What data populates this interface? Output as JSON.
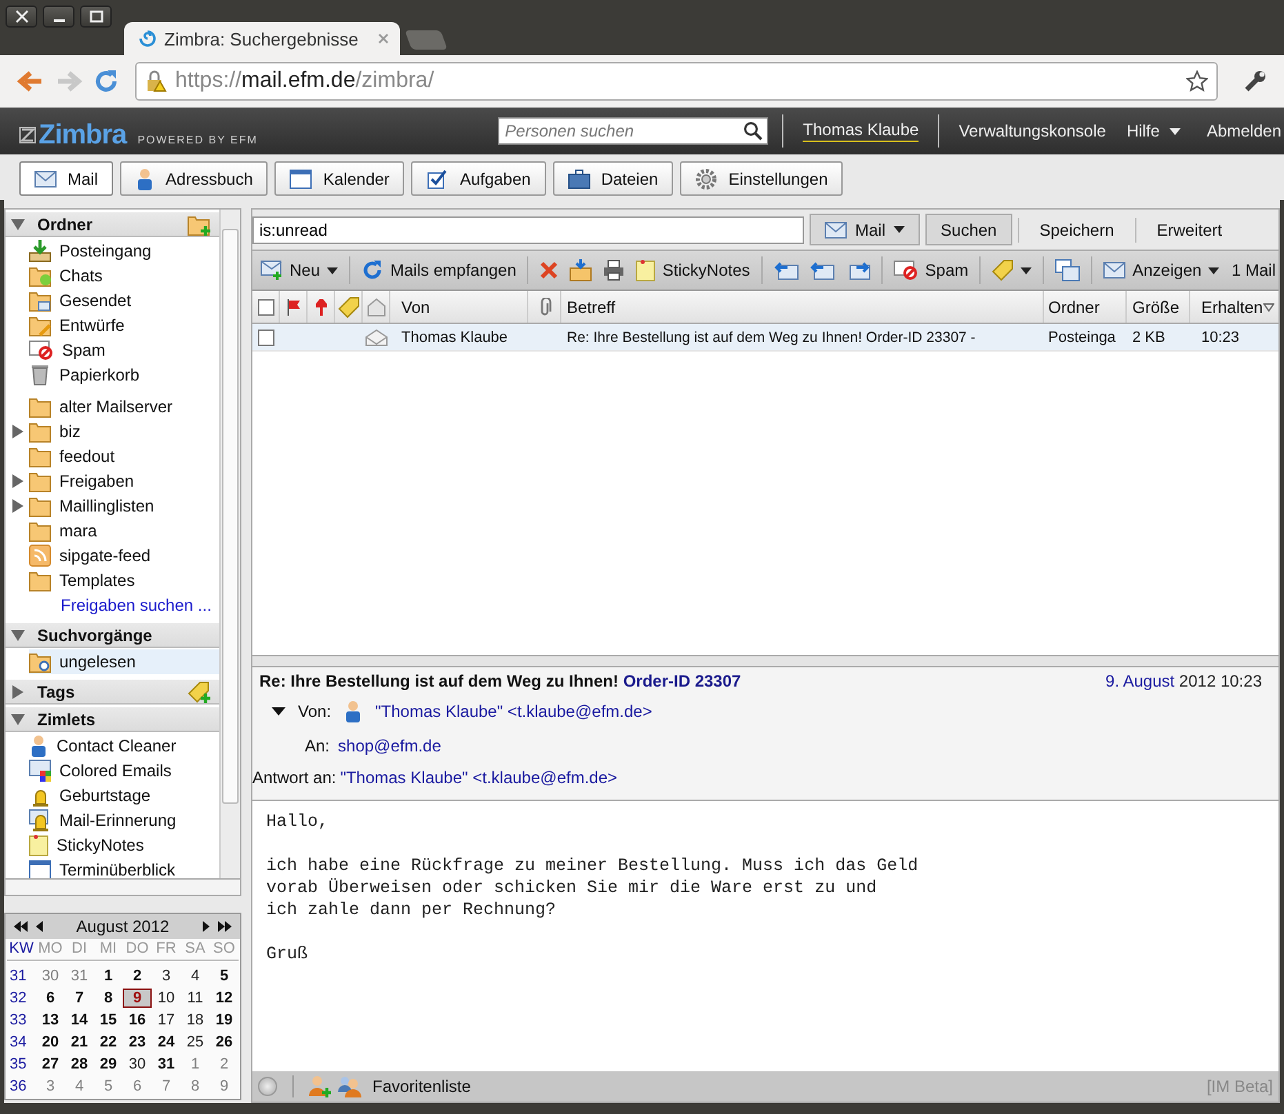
{
  "browser": {
    "tab_title": "Zimbra: Suchergebnisse",
    "url": {
      "scheme": "https://",
      "host": "mail.efm.de",
      "path": "/zimbra/"
    }
  },
  "header": {
    "logo": "Zimbra",
    "powered": "POWERED BY EFM",
    "people_search": {
      "placeholder": "Personen suchen"
    },
    "user": "Thomas Klaube",
    "links": [
      "Verwaltungskonsole",
      "Hilfe",
      "Abmelden"
    ]
  },
  "app_tabs": [
    {
      "label": "Mail",
      "kind": "mail",
      "selected": true
    },
    {
      "label": "Adressbuch",
      "kind": "contacts",
      "selected": false
    },
    {
      "label": "Kalender",
      "kind": "calendar",
      "selected": false
    },
    {
      "label": "Aufgaben",
      "kind": "tasks",
      "selected": false
    },
    {
      "label": "Dateien",
      "kind": "briefcase",
      "selected": false
    },
    {
      "label": "Einstellungen",
      "kind": "prefs",
      "selected": false
    }
  ],
  "sidebar": {
    "sections": [
      {
        "title": "Ordner",
        "expanded": true,
        "kind": "folders",
        "items": [
          {
            "label": "Posteingang",
            "kind": "inbox",
            "has_children": false,
            "selected": false
          },
          {
            "label": "Chats",
            "kind": "chats",
            "has_children": false,
            "selected": false
          },
          {
            "label": "Gesendet",
            "kind": "sent",
            "has_children": false,
            "selected": false
          },
          {
            "label": "Entwürfe",
            "kind": "drafts",
            "has_children": false,
            "selected": false
          },
          {
            "label": "Spam",
            "kind": "spam",
            "has_children": false,
            "selected": false
          },
          {
            "label": "Papierkorb",
            "kind": "trash",
            "has_children": false,
            "selected": false
          },
          {
            "label": "alter Mailserver",
            "kind": "folder",
            "has_children": false,
            "selected": false
          },
          {
            "label": "biz",
            "kind": "folder",
            "has_children": true,
            "selected": false
          },
          {
            "label": "feedout",
            "kind": "folder",
            "has_children": false,
            "selected": false
          },
          {
            "label": "Freigaben",
            "kind": "folder",
            "has_children": true,
            "selected": false
          },
          {
            "label": "Maillinglisten",
            "kind": "folder",
            "has_children": true,
            "selected": false
          },
          {
            "label": "mara",
            "kind": "folder",
            "has_children": false,
            "selected": false
          },
          {
            "label": "sipgate-feed",
            "kind": "rss",
            "has_children": false,
            "selected": false
          },
          {
            "label": "Templates",
            "kind": "folder",
            "has_children": false,
            "selected": false
          },
          {
            "label": "Freigaben suchen ...",
            "kind": "link"
          }
        ]
      },
      {
        "title": "Suchvorgänge",
        "expanded": true,
        "kind": "searches",
        "items": [
          {
            "label": "ungelesen",
            "kind": "search",
            "has_children": false,
            "selected": true
          }
        ]
      },
      {
        "title": "Tags",
        "expanded": false,
        "kind": "tags"
      },
      {
        "title": "Zimlets",
        "expanded": true,
        "kind": "zimlets",
        "items": [
          {
            "label": "Contact Cleaner",
            "kind": "cleaner",
            "has_children": false,
            "selected": false
          },
          {
            "label": "Colored Emails",
            "kind": "colored",
            "has_children": false,
            "selected": false
          },
          {
            "label": "Geburtstage",
            "kind": "bell",
            "has_children": false,
            "selected": false
          },
          {
            "label": "Mail-Erinnerung",
            "kind": "mailbell",
            "has_children": false,
            "selected": false
          },
          {
            "label": "StickyNotes",
            "kind": "note",
            "has_children": false,
            "selected": false
          },
          {
            "label": "Terminüberblick",
            "kind": "calendar",
            "has_children": false,
            "selected": false
          }
        ]
      }
    ]
  },
  "mini_calendar": {
    "title": "August 2012",
    "headers": [
      "KW",
      "MO",
      "DI",
      "MI",
      "DO",
      "FR",
      "SA",
      "SO"
    ],
    "weeks": [
      {
        "kw": "31",
        "days": [
          {
            "d": "30",
            "kind": "other",
            "selected": false
          },
          {
            "d": "31",
            "kind": "other",
            "selected": false
          },
          {
            "d": "1",
            "kind": "bold",
            "selected": false
          },
          {
            "d": "2",
            "kind": "bold",
            "selected": false
          },
          {
            "d": "3",
            "kind": "plain",
            "selected": false
          },
          {
            "d": "4",
            "kind": "plain",
            "selected": false
          },
          {
            "d": "5",
            "kind": "bold",
            "selected": false
          }
        ]
      },
      {
        "kw": "32",
        "days": [
          {
            "d": "6",
            "kind": "bold",
            "selected": false
          },
          {
            "d": "7",
            "kind": "bold",
            "selected": false
          },
          {
            "d": "8",
            "kind": "bold",
            "selected": false
          },
          {
            "d": "9",
            "kind": "bold",
            "selected": true
          },
          {
            "d": "10",
            "kind": "plain",
            "selected": false
          },
          {
            "d": "11",
            "kind": "plain",
            "selected": false
          },
          {
            "d": "12",
            "kind": "bold",
            "selected": false
          }
        ]
      },
      {
        "kw": "33",
        "days": [
          {
            "d": "13",
            "kind": "bold",
            "selected": false
          },
          {
            "d": "14",
            "kind": "bold",
            "selected": false
          },
          {
            "d": "15",
            "kind": "bold",
            "selected": false
          },
          {
            "d": "16",
            "kind": "bold",
            "selected": false
          },
          {
            "d": "17",
            "kind": "plain",
            "selected": false
          },
          {
            "d": "18",
            "kind": "plain",
            "selected": false
          },
          {
            "d": "19",
            "kind": "bold",
            "selected": false
          }
        ]
      },
      {
        "kw": "34",
        "days": [
          {
            "d": "20",
            "kind": "bold",
            "selected": false
          },
          {
            "d": "21",
            "kind": "bold",
            "selected": false
          },
          {
            "d": "22",
            "kind": "bold",
            "selected": false
          },
          {
            "d": "23",
            "kind": "bold",
            "selected": false
          },
          {
            "d": "24",
            "kind": "bold",
            "selected": false
          },
          {
            "d": "25",
            "kind": "plain",
            "selected": false
          },
          {
            "d": "26",
            "kind": "bold",
            "selected": false
          }
        ]
      },
      {
        "kw": "35",
        "days": [
          {
            "d": "27",
            "kind": "bold",
            "selected": false
          },
          {
            "d": "28",
            "kind": "bold",
            "selected": false
          },
          {
            "d": "29",
            "kind": "bold",
            "selected": false
          },
          {
            "d": "30",
            "kind": "plain",
            "selected": false
          },
          {
            "d": "31",
            "kind": "bold",
            "selected": false
          },
          {
            "d": "1",
            "kind": "other",
            "selected": false
          },
          {
            "d": "2",
            "kind": "other",
            "selected": false
          }
        ]
      },
      {
        "kw": "36",
        "days": [
          {
            "d": "3",
            "kind": "other",
            "selected": false
          },
          {
            "d": "4",
            "kind": "other",
            "selected": false
          },
          {
            "d": "5",
            "kind": "other",
            "selected": false
          },
          {
            "d": "6",
            "kind": "other",
            "selected": false
          },
          {
            "d": "7",
            "kind": "other",
            "selected": false
          },
          {
            "d": "8",
            "kind": "other",
            "selected": false
          },
          {
            "d": "9",
            "kind": "other",
            "selected": false
          }
        ]
      }
    ]
  },
  "search_bar": {
    "query": "is:unread",
    "type": "Mail",
    "buttons": [
      "Suchen",
      "Speichern",
      "Erweitert"
    ]
  },
  "toolbar": [
    {
      "kind": "new",
      "label": "Neu",
      "dropdown": true
    },
    {
      "kind": "sep"
    },
    {
      "kind": "refresh",
      "label": "Mails empfangen",
      "dropdown": false
    },
    {
      "kind": "sep"
    },
    {
      "kind": "delete",
      "dropdown": false
    },
    {
      "kind": "move",
      "dropdown": false
    },
    {
      "kind": "print",
      "dropdown": false
    },
    {
      "kind": "note",
      "label": "StickyNotes",
      "dropdown": false
    },
    {
      "kind": "sep"
    },
    {
      "kind": "reply",
      "dropdown": false
    },
    {
      "kind": "replyall",
      "dropdown": false
    },
    {
      "kind": "forward",
      "dropdown": false
    },
    {
      "kind": "sep"
    },
    {
      "kind": "spam",
      "label": "Spam",
      "dropdown": false
    },
    {
      "kind": "sep"
    },
    {
      "kind": "tag",
      "dropdown": true
    },
    {
      "kind": "sep"
    },
    {
      "kind": "view",
      "dropdown": false
    },
    {
      "kind": "sep"
    },
    {
      "kind": "mail",
      "label": "Anzeigen",
      "dropdown": true
    },
    {
      "kind": "count",
      "label": "1 Mail"
    }
  ],
  "message_list": {
    "select_all_checked": false,
    "columns": [
      "Von",
      "Betreff",
      "Ordner",
      "Größe",
      "Erhalten"
    ],
    "rows": [
      {
        "from": "Thomas Klaube",
        "subject": "Re: Ihre Bestellung ist auf dem Weg zu Ihnen! Order-ID 23307 -",
        "folder": "Posteinga",
        "size": "2 KB",
        "received": "10:23",
        "selected": true,
        "checked": false,
        "unread": false
      }
    ]
  },
  "reading_pane": {
    "subject": "Re: Ihre Bestellung ist auf dem Weg zu Ihnen!",
    "subject_link": "Order-ID 23307",
    "date_link": "9. August",
    "date_rest": "2012 10:23",
    "fields": [
      {
        "label": "Von:",
        "name": "\"Thomas Klaube\"",
        "email": "<t.klaube@efm.de>",
        "kind": "from"
      },
      {
        "label": "An:",
        "email": "shop@efm.de",
        "kind": "to"
      },
      {
        "label": "Antwort an:",
        "name": "\"Thomas Klaube\"",
        "email": "<t.klaube@efm.de>",
        "kind": "replyto"
      }
    ],
    "body": [
      [
        "Hallo,"
      ],
      [
        "ich habe eine Rückfrage zu meiner Bestellung. Muss ich das Geld",
        "vorab Überweisen oder schicken Sie mir die Ware erst zu und",
        "ich zahle dann per Rechnung?"
      ],
      [
        "Gruß"
      ]
    ]
  },
  "im_bar": {
    "label": "Favoritenliste",
    "beta": "[IM Beta]"
  }
}
